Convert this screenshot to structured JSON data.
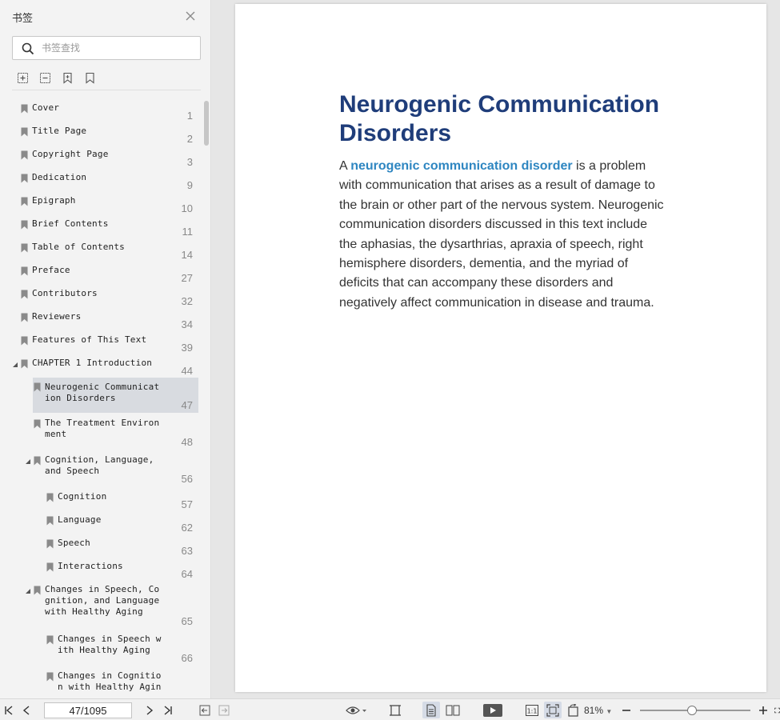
{
  "sidebar": {
    "title": "书签",
    "search": {
      "placeholder": "书签查找",
      "value": ""
    },
    "bookmarks": [
      {
        "label": "Cover",
        "page": "1",
        "level": 0
      },
      {
        "label": "Title Page",
        "page": "2",
        "level": 0
      },
      {
        "label": "Copyright Page",
        "page": "3",
        "level": 0
      },
      {
        "label": "Dedication",
        "page": "9",
        "level": 0
      },
      {
        "label": "Epigraph",
        "page": "10",
        "level": 0
      },
      {
        "label": "Brief Contents",
        "page": "11",
        "level": 0
      },
      {
        "label": "Table of Contents",
        "page": "14",
        "level": 0
      },
      {
        "label": "Preface",
        "page": "27",
        "level": 0
      },
      {
        "label": "Contributors",
        "page": "32",
        "level": 0
      },
      {
        "label": "Reviewers",
        "page": "34",
        "level": 0
      },
      {
        "label": "Features of This Text",
        "page": "39",
        "level": 0
      },
      {
        "label": "CHAPTER 1 Introduction",
        "page": "44",
        "level": 0,
        "expanded": true
      },
      {
        "label": "Neurogenic Communicat\nion Disorders",
        "page": "47",
        "level": 1,
        "selected": true
      },
      {
        "label": "The Treatment Environ\nment",
        "page": "48",
        "level": 1
      },
      {
        "label": "Cognition, Language,\nand Speech",
        "page": "56",
        "level": 1,
        "expanded": true
      },
      {
        "label": "Cognition",
        "page": "57",
        "level": 2
      },
      {
        "label": "Language",
        "page": "62",
        "level": 2
      },
      {
        "label": "Speech",
        "page": "63",
        "level": 2
      },
      {
        "label": "Interactions",
        "page": "64",
        "level": 2
      },
      {
        "label": "Changes in Speech, Co\ngnition, and Language\nwith Healthy Aging",
        "page": "65",
        "level": 1,
        "expanded": true
      },
      {
        "label": "Changes in Speech w\nith Healthy Aging",
        "page": "66",
        "level": 2
      },
      {
        "label": "Changes in Cognitio\nn with Healthy Agin",
        "page": "",
        "level": 2
      }
    ]
  },
  "document": {
    "title": "Neurogenic Communication Disorders",
    "body_prefix": "A ",
    "body_term": "neurogenic communication disorder",
    "body_rest": " is a problem with communication that arises as a result of damage to the brain or other part of the nervous system. Neurogenic communication disorders discussed in this text include the aphasias, the dysarthrias, apraxia of speech, right hemisphere disorders, dementia, and the myriad of deficits that can accompany these disorders and negatively affect communication in disease and trauma."
  },
  "statusbar": {
    "page_indicator": "47/1095",
    "zoom": "81%",
    "zoom_level_percent": 81
  },
  "colors": {
    "title": "#1f3d7a",
    "term": "#2e86c1",
    "selected_bookmark": "#d8dbe0"
  }
}
